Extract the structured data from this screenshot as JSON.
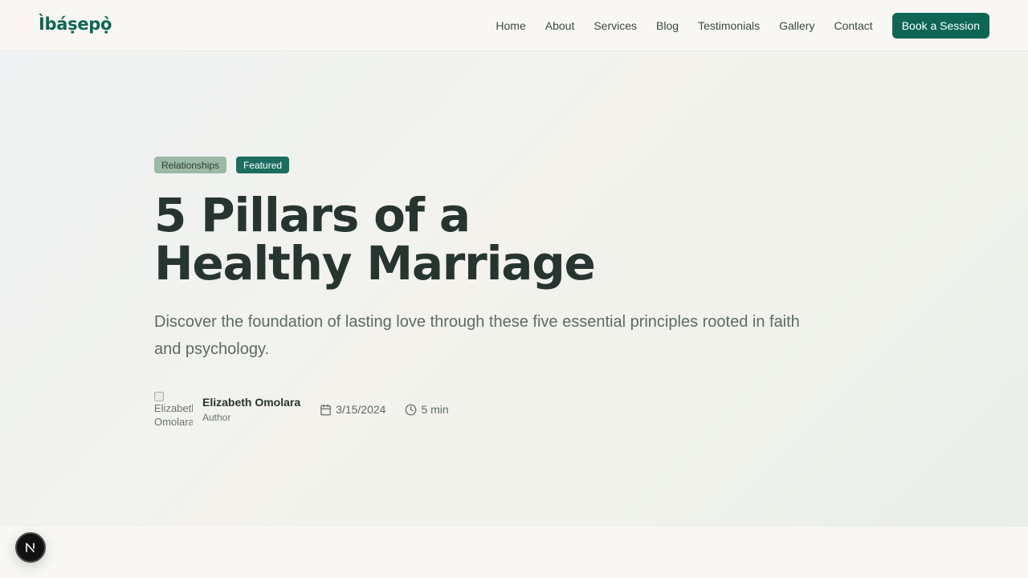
{
  "header": {
    "logo": "Ìbáṣepọ̀",
    "nav": [
      "Home",
      "About",
      "Services",
      "Blog",
      "Testimonials",
      "Gallery",
      "Contact"
    ],
    "cta_label": "Book a Session",
    "accent_color": "#0f6655"
  },
  "article": {
    "tags": [
      "Relationships",
      "Featured"
    ],
    "title": "5 Pillars of a Healthy Marriage",
    "subtitle": "Discover the foundation of lasting love through these five essential principles rooted in faith and psychology.",
    "author": {
      "avatar_alt": "Elizabeth Omolara",
      "name": "Elizabeth Omolara",
      "role": "Author"
    },
    "date": "3/15/2024",
    "read_time": "5 min"
  },
  "dev_badge": {
    "label": "N",
    "icon": "nextjs-icon"
  }
}
